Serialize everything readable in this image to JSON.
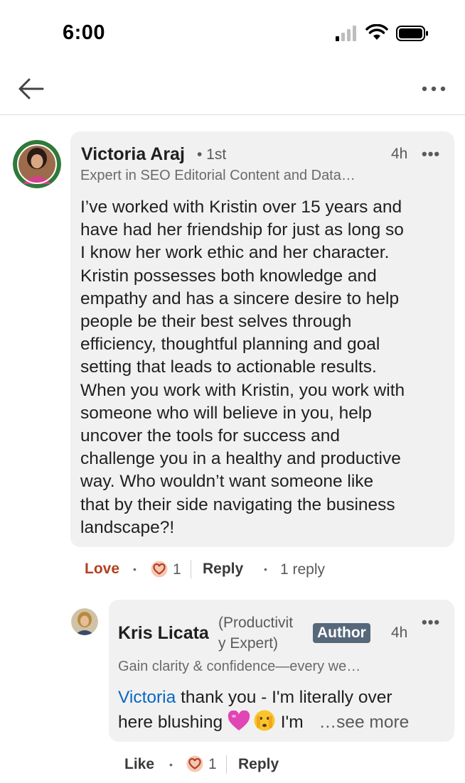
{
  "status_bar": {
    "time": "6:00"
  },
  "comment": {
    "author": "Victoria Araj",
    "degree": "• 1st",
    "time": "4h",
    "more": "•••",
    "headline": "Expert in SEO Editorial Content and Data…",
    "text_lines": [
      "I’ve worked with Kristin over 15 years and",
      "have had her friendship for just as long so",
      "I know her work ethic and her character.",
      "Kristin possesses both knowledge and",
      "empathy and has a sincere desire to help",
      "people be their best selves through",
      "efficiency, thoughtful planning and goal",
      "setting that leads to actionable results.",
      "When you work with Kristin, you work with",
      "someone who will believe in you, help",
      "uncover the tools for success and",
      "challenge you in a healthy and productive",
      "way. Who wouldn’t want someone like",
      "that by their side navigating the business",
      "landscape?!"
    ],
    "actions": {
      "reaction_label": "Love",
      "reaction_count": "1",
      "reply_label": "Reply",
      "reply_count": "1 reply"
    }
  },
  "reply": {
    "author": "Kris Licata",
    "pronoun_line1": "(Productivit",
    "pronoun_line2": "y Expert)",
    "badge": "Author",
    "time": "4h",
    "more": "•••",
    "headline": "Gain clarity & confidence—every we…",
    "mention": "Victoria",
    "text_line1_rest": " thank you - I'm literally over",
    "text_line2_start": "here blushing ",
    "text_line2_after": " I'm",
    "see_more": "…see more",
    "actions": {
      "like_label": "Like",
      "reaction_count": "1",
      "reply_label": "Reply"
    }
  },
  "colors": {
    "bubble": "#f1f1f1",
    "love": "#b24020",
    "mention": "#0a66c2",
    "author_badge": "#56687a"
  },
  "icons": [
    "signal-icon",
    "wifi-icon",
    "battery-icon",
    "back-arrow-icon",
    "overflow-menu-icon",
    "heart-reaction-icon",
    "pink-heart-emoji",
    "peeking-face-emoji"
  ]
}
